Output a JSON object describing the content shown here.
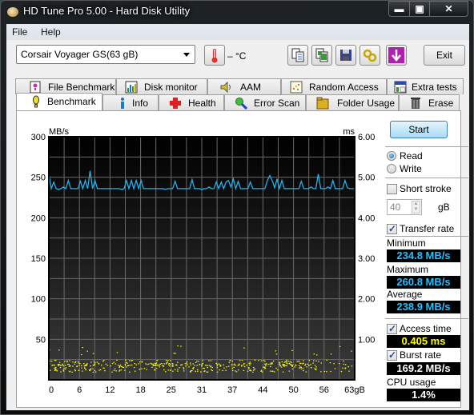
{
  "window": {
    "title": "HD Tune Pro 5.00 - Hard Disk Utility",
    "controls": {
      "minimize": "▬",
      "maximize": "▣",
      "close": "✕"
    }
  },
  "menu": {
    "items": [
      {
        "label": "File",
        "accel": "F"
      },
      {
        "label": "Help",
        "accel": "H"
      }
    ]
  },
  "toolbar": {
    "drive_name": "Corsair Voyager GS",
    "drive_capacity": "(63 gB)",
    "temperature": "– °C",
    "icons": [
      "copy-text-icon",
      "copy-screenshot-icon",
      "save-icon",
      "options-icon",
      "download-icon"
    ],
    "exit_label": "Exit"
  },
  "tabs": {
    "back_row": [
      {
        "label": "File Benchmark",
        "icon": "file-benchmark-icon"
      },
      {
        "label": "Disk monitor",
        "icon": "disk-monitor-icon"
      },
      {
        "label": "AAM",
        "icon": "speaker-icon"
      },
      {
        "label": "Random Access",
        "icon": "random-access-icon"
      },
      {
        "label": "Extra tests",
        "icon": "extra-tests-icon"
      }
    ],
    "front_row": [
      {
        "label": "Benchmark",
        "icon": "benchmark-icon",
        "active": true
      },
      {
        "label": "Info",
        "icon": "info-icon"
      },
      {
        "label": "Health",
        "icon": "health-cross-icon"
      },
      {
        "label": "Error Scan",
        "icon": "magnifier-icon"
      },
      {
        "label": "Folder Usage",
        "icon": "folder-icon"
      },
      {
        "label": "Erase",
        "icon": "trash-icon"
      }
    ]
  },
  "side": {
    "start_label": "Start",
    "read_label": "Read",
    "write_label": "Write",
    "mode": "Read",
    "short_stroke_label": "Short stroke",
    "short_stroke_checked": false,
    "short_stroke_value": "40",
    "short_stroke_unit": "gB",
    "transfer_rate_label": "Transfer rate",
    "transfer_rate_checked": true,
    "minimum_label": "Minimum",
    "minimum_value": "234.8 MB/s",
    "maximum_label": "Maximum",
    "maximum_value": "260.8 MB/s",
    "average_label": "Average",
    "average_value": "238.9 MB/s",
    "access_time_label": "Access time",
    "access_time_checked": true,
    "access_time_value": "0.405 ms",
    "burst_rate_label": "Burst rate",
    "burst_rate_checked": true,
    "burst_rate_value": "169.2 MB/s",
    "cpu_usage_label": "CPU usage",
    "cpu_usage_value": "1.4%"
  },
  "colors": {
    "transfer_line": "#1eb4f0",
    "access_points": "#ffff00",
    "value_cyan": "#1ec0ff",
    "value_yellow": "#ffff00"
  },
  "chart_data": {
    "type": "line",
    "title": "",
    "xlabel": "gB",
    "ylabel": "MB/s",
    "y2label": "ms",
    "xlim": [
      0,
      63
    ],
    "ylim": [
      0,
      300
    ],
    "y2lim": [
      0,
      6
    ],
    "x_ticks": [
      "0",
      "6",
      "12",
      "18",
      "25",
      "31",
      "37",
      "44",
      "50",
      "56",
      "63gB"
    ],
    "y_ticks": [
      "0",
      "50",
      "100",
      "150",
      "200",
      "250",
      "300"
    ],
    "y2_ticks": [
      "1.00",
      "2.00",
      "3.00",
      "4.00",
      "5.00",
      "6.00"
    ],
    "grid": true,
    "series": [
      {
        "name": "Transfer rate",
        "axis": "left",
        "x": [
          0,
          0.5,
          1,
          1.5,
          2,
          2.5,
          3,
          3.5,
          4,
          4.5,
          5,
          5.5,
          6,
          6.5,
          7,
          7.5,
          8,
          8.5,
          9,
          9.5,
          10,
          10.5,
          11,
          11.5,
          12,
          12.5,
          13,
          13.5,
          14,
          14.5,
          15,
          15.5,
          16,
          16.5,
          17,
          17.5,
          18,
          18.5,
          19,
          19.5,
          20,
          20.5,
          21,
          21.5,
          22,
          22.5,
          23,
          23.5,
          24,
          24.5,
          25,
          25.5,
          26,
          26.5,
          27,
          27.5,
          28,
          28.5,
          29,
          29.5,
          30,
          30.5,
          31,
          31.5,
          32,
          32.5,
          33,
          33.5,
          34,
          34.5,
          35,
          35.5,
          36,
          36.5,
          37,
          37.5,
          38,
          38.5,
          39,
          39.5,
          40,
          40.5,
          41,
          41.5,
          42,
          42.5,
          43,
          43.5,
          44,
          44.5,
          45,
          45.5,
          46,
          46.5,
          47,
          47.5,
          48,
          48.5,
          49,
          49.5,
          50,
          50.5,
          51,
          51.5,
          52,
          52.5,
          53,
          53.5,
          54,
          54.5,
          55,
          55.5,
          56,
          56.5,
          57,
          57.5,
          58,
          58.5,
          59,
          59.5,
          60,
          60.5,
          61,
          61.5,
          62,
          62.5,
          63
        ],
        "values": [
          255,
          236,
          244,
          236,
          235,
          236,
          238,
          236,
          246,
          236,
          236,
          236,
          236,
          245,
          236,
          246,
          236,
          258,
          236,
          246,
          236,
          236,
          236,
          236,
          236,
          236,
          236,
          236,
          236,
          236,
          235,
          236,
          246,
          236,
          246,
          236,
          246,
          236,
          246,
          236,
          236,
          236,
          236,
          236,
          236,
          236,
          236,
          236,
          235,
          236,
          236,
          236,
          245,
          236,
          236,
          236,
          236,
          236,
          236,
          247,
          236,
          236,
          236,
          235,
          236,
          236,
          238,
          236,
          236,
          244,
          236,
          244,
          236,
          244,
          246,
          238,
          248,
          236,
          245,
          236,
          236,
          236,
          236,
          244,
          236,
          236,
          236,
          236,
          236,
          236,
          246,
          252,
          246,
          237,
          248,
          236,
          246,
          236,
          236,
          236,
          236,
          236,
          236,
          236,
          245,
          236,
          236,
          236,
          238,
          236,
          236,
          254,
          236,
          236,
          236,
          238,
          236,
          246,
          236,
          236,
          236,
          236,
          246,
          237,
          236,
          236,
          236,
          236,
          236,
          236,
          236,
          244,
          236
        ]
      },
      {
        "name": "Access time",
        "axis": "right",
        "type": "scatter",
        "note": "dense scatter of access-time points mostly between 0.2 and 0.6 ms, a few up to ~0.85 ms; tapering past ~55 gB"
      }
    ]
  }
}
